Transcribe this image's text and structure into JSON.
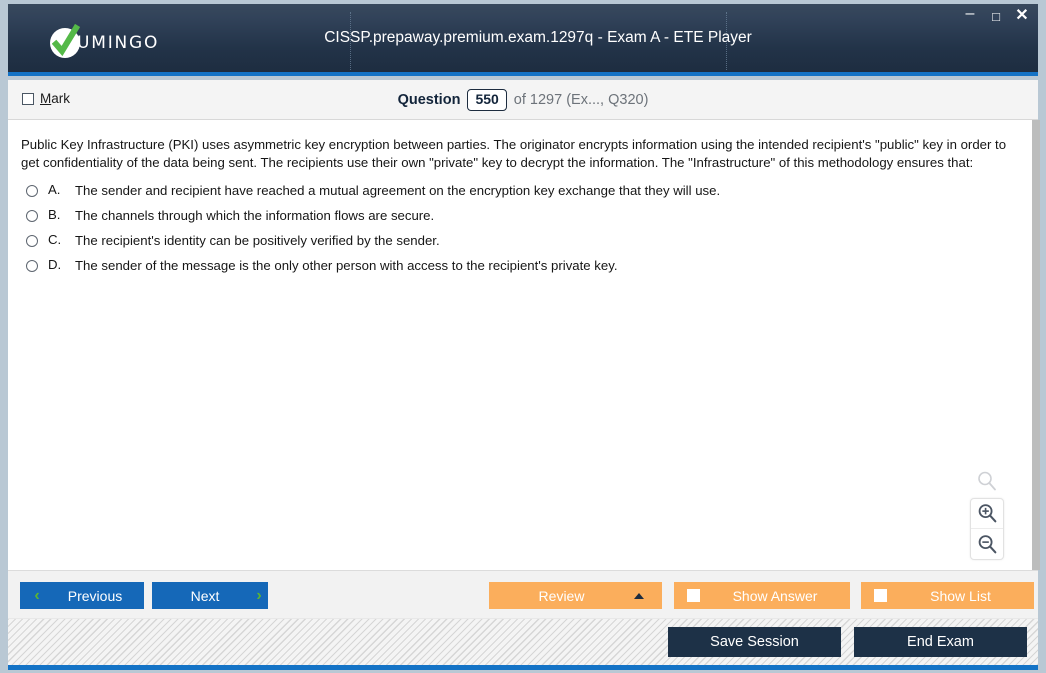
{
  "window": {
    "brand": "UMINGO",
    "title": "CISSP.prepaway.premium.exam.1297q - Exam A - ETE Player",
    "controls": {
      "minimize": "–",
      "maximize": "□",
      "close": "✕"
    }
  },
  "status_bar": {
    "mark_accel": "M",
    "mark_rest": "ark",
    "question_word": "Question",
    "question_number": "550",
    "of_total": "of 1297 (Ex..., Q320)"
  },
  "question": {
    "text": "Public Key Infrastructure (PKI) uses asymmetric key encryption between parties. The originator encrypts information using the intended recipient's \"public\" key in order to get confidentiality of the data being sent. The recipients use their own \"private\" key to decrypt the information. The \"Infrastructure\" of this methodology ensures that:",
    "options": [
      {
        "letter": "A.",
        "text": "The sender and recipient have reached a mutual agreement on the encryption key exchange that they will use.",
        "selected": false
      },
      {
        "letter": "B.",
        "text": "The channels through which the information flows are secure.",
        "selected": false
      },
      {
        "letter": "C.",
        "text": "The recipient's identity can be positively verified by the sender.",
        "selected": false
      },
      {
        "letter": "D.",
        "text": "The sender of the message is the only other person with access to the recipient's private key.",
        "selected": false
      }
    ]
  },
  "zoom_controls": {
    "reset_name": "zoom-reset",
    "in_name": "zoom-in",
    "out_name": "zoom-out"
  },
  "toolbar": {
    "previous_label": "Previous",
    "previous_chevron": "‹",
    "next_label": "Next",
    "next_chevron": "›",
    "review_label": "Review",
    "show_answer_label": "Show Answer",
    "show_list_label": "Show List"
  },
  "footer": {
    "save_session_label": "Save Session",
    "end_exam_label": "End Exam"
  },
  "colors": {
    "title_bar": "#223348",
    "accent_blue": "#1473c6",
    "nav_blue": "#1568b8",
    "chevron_green": "#5cb531",
    "amber": "#fbae5c",
    "dark_navy": "#1d3147",
    "window_border": "#b9c8d4"
  }
}
